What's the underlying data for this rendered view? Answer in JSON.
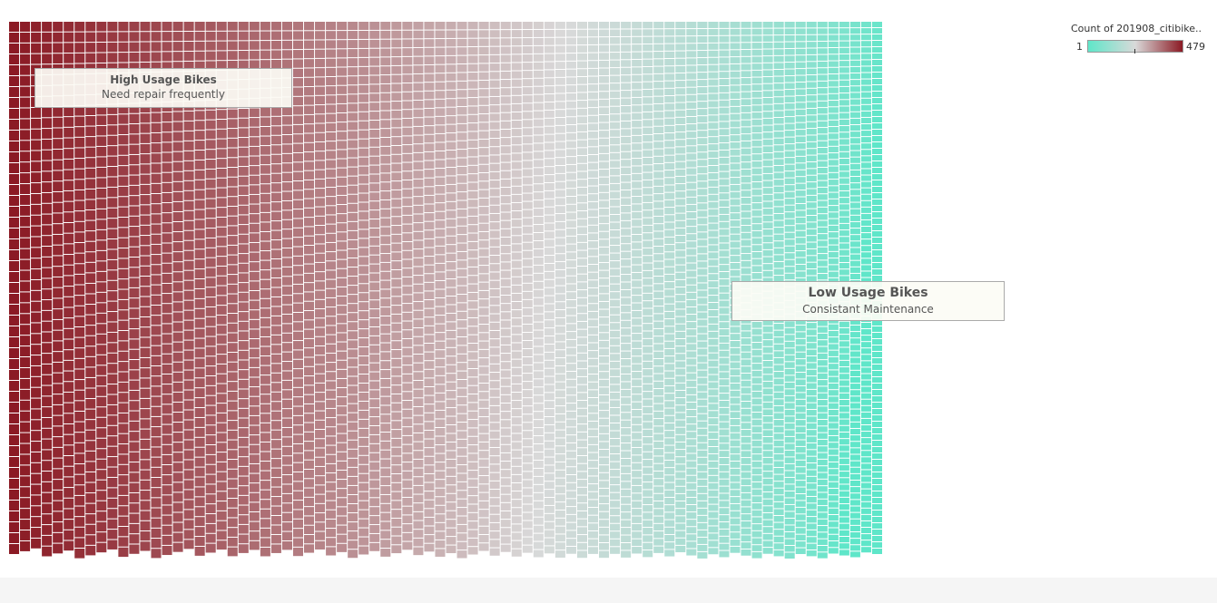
{
  "chart_data": {
    "type": "heatmap",
    "subtype": "treemap",
    "measure": "Count of 201908_citibike..",
    "color_scale": {
      "min": 1,
      "max": 479,
      "colors": [
        "#5fe6c9",
        "#d9d9d9",
        "#8b1a24"
      ]
    },
    "distribution": "cells sorted descending by count from left column to right; darkest red (high counts) at left edge, fading through grey to turquoise (low counts) toward right and bottom-right",
    "annotations": [
      {
        "title": "High Usage Bikes",
        "text": "Need repair frequently"
      },
      {
        "title": "Low Usage Bikes",
        "text": "Consistant Maintenance"
      }
    ]
  },
  "legend": {
    "title": "Count of 201908_citibike..",
    "min_label": "1",
    "max_label": "479"
  }
}
